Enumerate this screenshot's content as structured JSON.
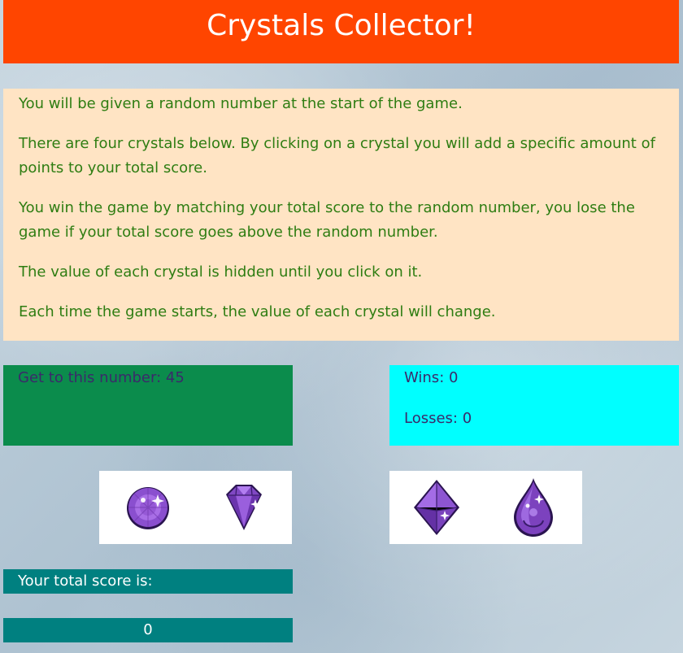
{
  "header": {
    "title": "Crystals Collector!"
  },
  "instructions": [
    "You will be given a random number at the start of the game.",
    "There are four crystals below. By clicking on a crystal you will add a specific amount of points to your total score.",
    "You win the game by matching your total score to the random number, you lose the game if your total score goes above the random number.",
    "The value of each crystal is hidden until you click on it.",
    "Each time the game starts, the value of each crystal will change."
  ],
  "target": {
    "label": "Get to this number: 45"
  },
  "stats": {
    "wins_label": "Wins: 0",
    "losses_label": "Losses: 0"
  },
  "crystals": [
    {
      "icon": "round-purple-gem-icon"
    },
    {
      "icon": "diamond-purple-gem-icon"
    },
    {
      "icon": "octahedron-purple-gem-icon"
    },
    {
      "icon": "teardrop-purple-gem-icon"
    }
  ],
  "score": {
    "label": "Your total score is:",
    "value": "0"
  },
  "colors": {
    "title_bar": "#ff4500",
    "instructions_bg": "#ffe4c4",
    "instructions_text": "#2e7d12",
    "target_bg": "#0b8c4c",
    "stats_bg": "#00ffff",
    "score_bg": "#008080",
    "gem_purple": "#7b3fb0"
  }
}
